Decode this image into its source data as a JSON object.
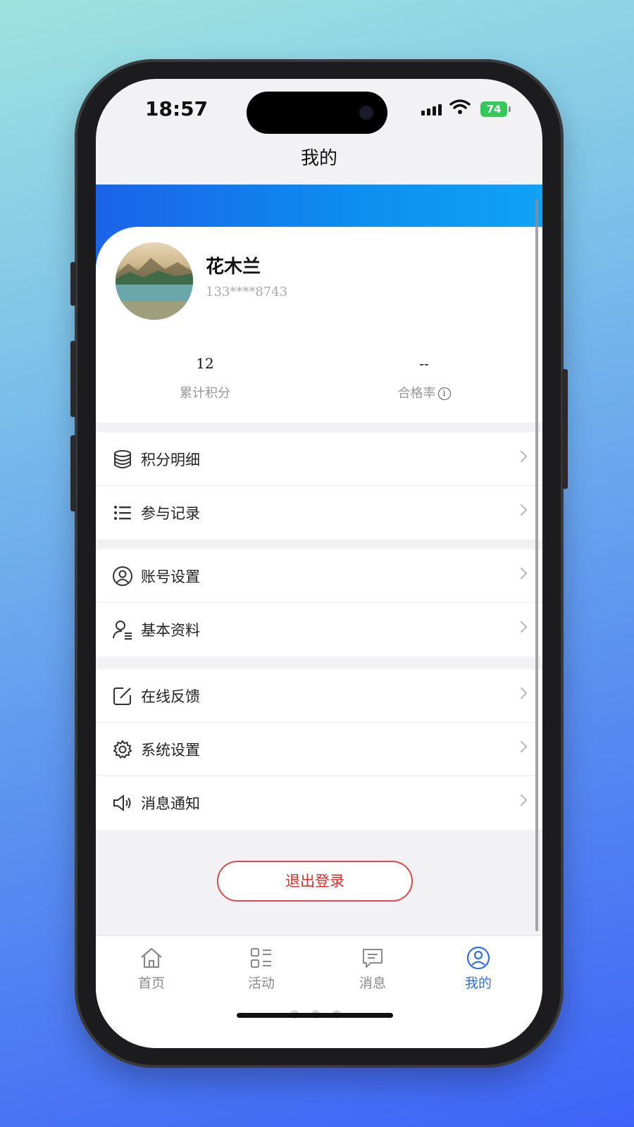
{
  "status_bar": {
    "time": "18:57",
    "battery": "74"
  },
  "header": {
    "title": "我的"
  },
  "profile": {
    "name": "花木兰",
    "phone": "133****8743"
  },
  "stats": [
    {
      "value": "12",
      "label": "累计积分"
    },
    {
      "value": "--",
      "label": "合格率"
    }
  ],
  "menu": {
    "group1": [
      {
        "label": "积分明细",
        "icon": "database-icon"
      },
      {
        "label": "参与记录",
        "icon": "list-icon"
      }
    ],
    "group2": [
      {
        "label": "账号设置",
        "icon": "user-circle-icon"
      },
      {
        "label": "基本资料",
        "icon": "user-profile-icon"
      }
    ],
    "group3": [
      {
        "label": "在线反馈",
        "icon": "edit-icon"
      },
      {
        "label": "系统设置",
        "icon": "gear-icon"
      },
      {
        "label": "消息通知",
        "icon": "speaker-icon"
      }
    ]
  },
  "logout_label": "退出登录",
  "tabs": [
    {
      "label": "首页",
      "icon": "home-icon"
    },
    {
      "label": "活动",
      "icon": "activity-grid-icon"
    },
    {
      "label": "消息",
      "icon": "message-icon"
    },
    {
      "label": "我的",
      "icon": "user-circle-icon",
      "active": true
    }
  ],
  "colors": {
    "accent": "#2f6fe0",
    "danger": "#d93030",
    "header_blue": "#0d8ff0"
  }
}
